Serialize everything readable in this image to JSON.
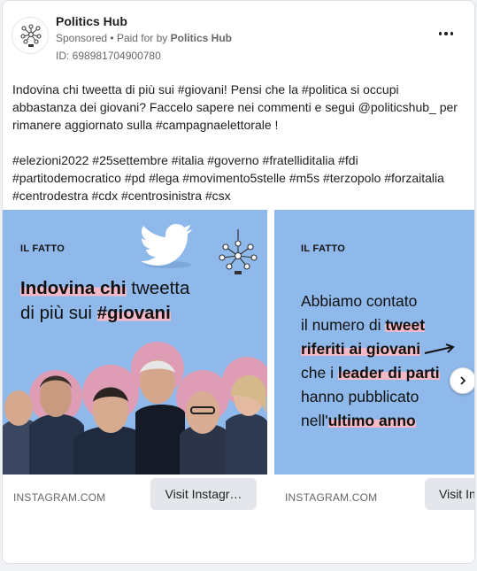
{
  "post": {
    "page_name": "Politics Hub",
    "sponsored": "Sponsored",
    "paid_for_prefix": "Paid for by",
    "paid_for_by": "Politics Hub",
    "separator": "•",
    "ad_id": "ID: 698981704900780",
    "body": "Indovina chi tweetta di più sui #giovani! Pensi che la #politica si occupi abbastanza dei giovani? Faccelo sapere nei commenti e segui @politicshub_ per rimanere aggiornato sulla #campagnaelettorale !",
    "hashtags": "#elezioni2022 #25settembre #italia #governo #fratelliditalia #fdi #partitodemocratico #pd #lega #movimento5stelle #m5s #terzopolo #forzaitalia #centrodestra #cdx #centrosinistra #csx"
  },
  "cards": [
    {
      "tag": "IL FATTO",
      "headline_1": "Indovina chi",
      "headline_2": " tweetta",
      "headline_3": "di più sui ",
      "headline_4": "#giovani",
      "domain": "INSTAGRAM.COM",
      "cta": "Visit Instagr…"
    },
    {
      "tag": "IL FATTO",
      "line_1": "Abbiamo contato",
      "line_2a": "il numero di ",
      "line_2b": "tweet",
      "line_3": "riferiti ai giovani",
      "line_4a": "che i ",
      "line_4b": "leader di par",
      "line_4c": "ti",
      "line_5": "hanno pubblicato",
      "line_6a": "nell'",
      "line_6b": "ultimo anno",
      "domain": "INSTAGRAM.COM",
      "cta": "Visit Ins"
    }
  ],
  "colors": {
    "creative_bg": "#8fb9ea",
    "highlight": "#f4b8c6",
    "cta_bg": "#e4e6eb",
    "muted_text": "#65676b"
  },
  "icons": [
    "logo-icon",
    "more-options-icon",
    "twitter-bird-icon",
    "network-bulb-icon",
    "arrow-icon",
    "chevron-right-icon"
  ]
}
